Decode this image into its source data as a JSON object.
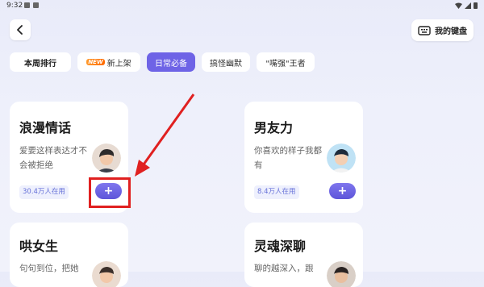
{
  "status_bar": {
    "time": "9:32"
  },
  "header": {
    "keyboard_label": "我的键盘"
  },
  "tabs": [
    {
      "label": "本周排行",
      "active": false
    },
    {
      "label": "新上架",
      "badge": "NEW",
      "active": false
    },
    {
      "label": "日常必备",
      "active": true
    },
    {
      "label": "搞怪幽默",
      "active": false
    },
    {
      "label": "\"嘴强\"王者",
      "active": false
    }
  ],
  "cards": [
    {
      "title": "浪漫情话",
      "desc": "爱要这样表达才不会被拒绝",
      "usage": "30.4万人在用",
      "add": "+"
    },
    {
      "title": "男友力",
      "desc": "你喜欢的样子我都有",
      "usage": "8.4万人在用",
      "add": "+"
    },
    {
      "title": "哄女生",
      "desc": "句句到位，把她"
    },
    {
      "title": "灵魂深聊",
      "desc": "聊的越深入，跟"
    }
  ],
  "colors": {
    "accent": "#6e63e6",
    "annotation": "#e02020"
  }
}
